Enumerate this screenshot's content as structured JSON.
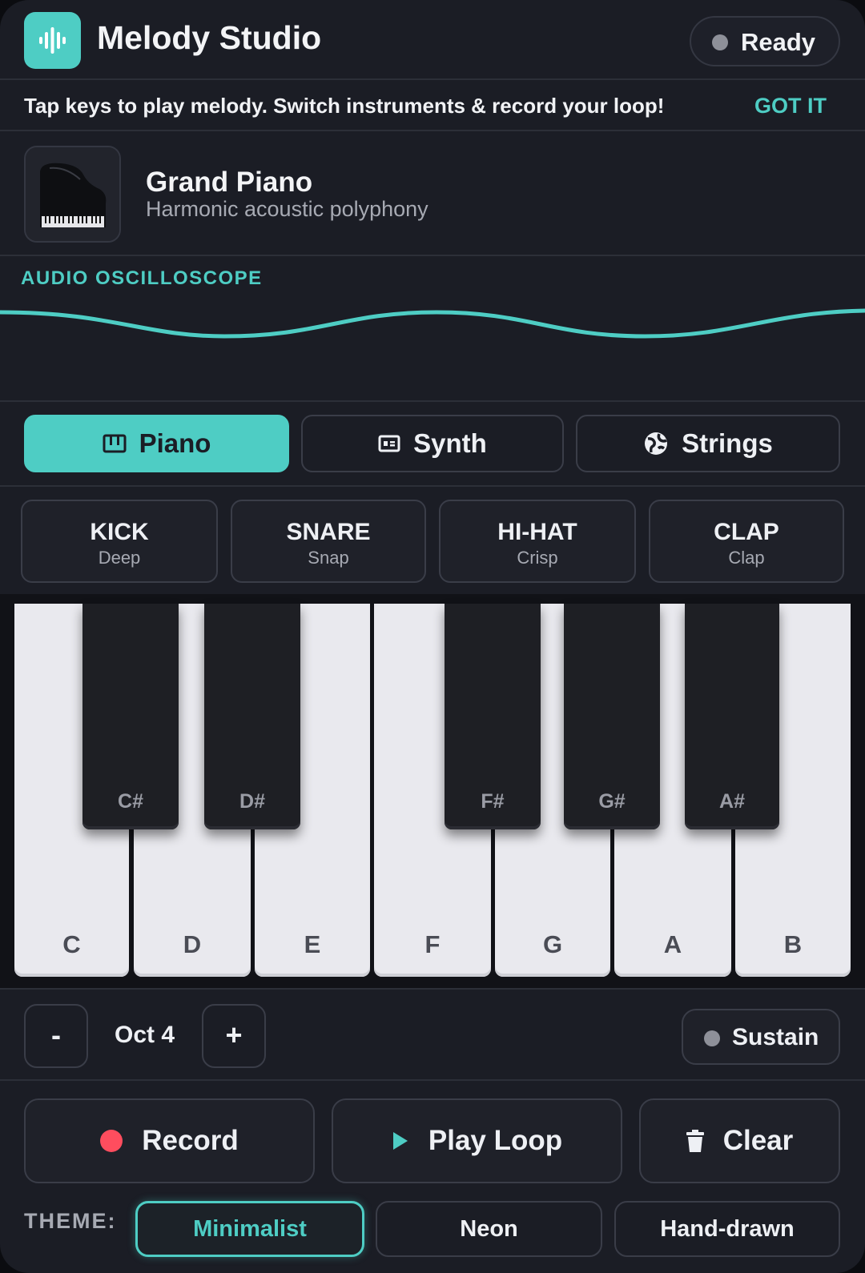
{
  "app": {
    "title": "Melody Studio",
    "status": "Ready",
    "accent": "#4ecdc4"
  },
  "hint": {
    "text": "Tap keys to play melody. Switch instruments & record your loop!",
    "dismiss": "GOT IT"
  },
  "instrument": {
    "name": "Grand Piano",
    "description": "Harmonic acoustic polyphony",
    "icon": "grand-piano-image"
  },
  "scope": {
    "label": "AUDIO OSCILLOSCOPE"
  },
  "tabs": [
    {
      "label": "Piano",
      "icon": "piano-icon",
      "active": true
    },
    {
      "label": "Synth",
      "icon": "synth-icon",
      "active": false
    },
    {
      "label": "Strings",
      "icon": "strings-icon",
      "active": false
    }
  ],
  "pads": [
    {
      "name": "KICK",
      "sub": "Deep"
    },
    {
      "name": "SNARE",
      "sub": "Snap"
    },
    {
      "name": "HI-HAT",
      "sub": "Crisp"
    },
    {
      "name": "CLAP",
      "sub": "Clap"
    }
  ],
  "keys": {
    "white": [
      "C",
      "D",
      "E",
      "F",
      "G",
      "A",
      "B"
    ],
    "black": [
      "C#",
      "D#",
      "F#",
      "G#",
      "A#"
    ]
  },
  "octave": {
    "minus": "-",
    "label": "Oct 4",
    "plus": "+",
    "sustain": "Sustain"
  },
  "transport": {
    "record": "Record",
    "play": "Play Loop",
    "clear": "Clear",
    "record_color": "#ff4d5e"
  },
  "theme": {
    "label": "THEME:",
    "options": [
      "Minimalist",
      "Neon",
      "Hand-drawn"
    ],
    "selected": "Minimalist"
  }
}
